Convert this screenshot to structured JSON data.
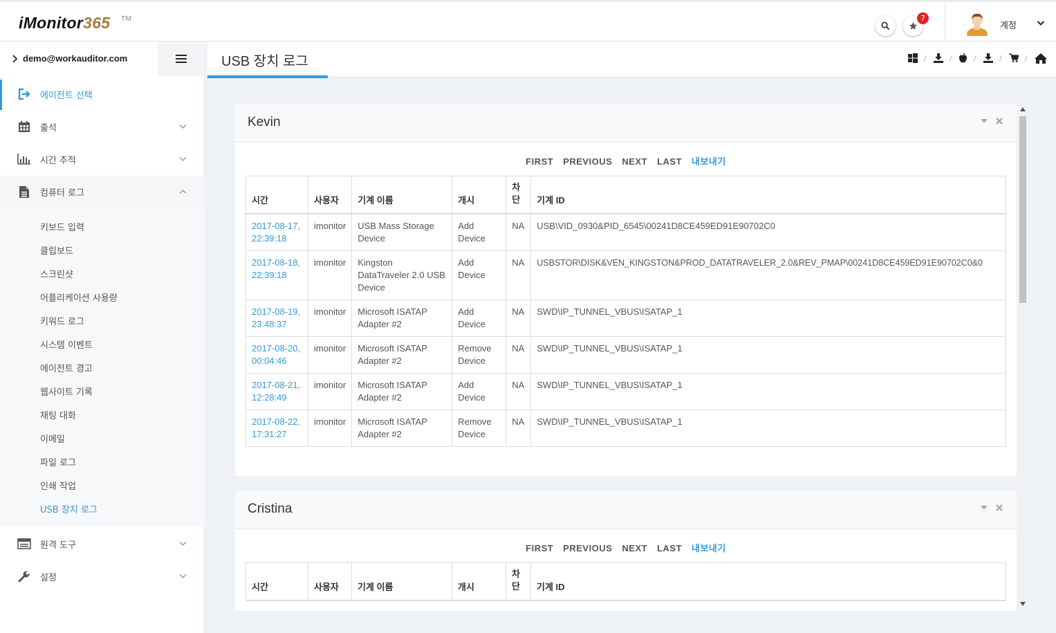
{
  "app": {
    "logo_i": "iMonitor",
    "logo_n": "365",
    "tm": "TM"
  },
  "header": {
    "badge_count": "7",
    "account_label": "계정"
  },
  "sidebar": {
    "user": "demo@workauditor.com",
    "items": [
      {
        "label": "에이전트 선택",
        "icon": "sign-in-icon",
        "active": true
      },
      {
        "label": "출석",
        "icon": "calendar-icon"
      },
      {
        "label": "시간 추적",
        "icon": "bar-chart-icon"
      },
      {
        "label": "컴퓨터 로그",
        "icon": "file-icon",
        "expanded": true
      },
      {
        "label": "원격 도구",
        "icon": "list-icon"
      },
      {
        "label": "설정",
        "icon": "wrench-icon"
      }
    ],
    "subitems": [
      "키보드 입력",
      "클립보드",
      "스크린샷",
      "어플리케이션 사용량",
      "키워드 로그",
      "시스템 이벤트",
      "에이전트 경고",
      "웹사이트 기록",
      "채팅 대화",
      "이메일",
      "파일 로그",
      "인쇄 작업",
      "USB 장치 로그"
    ]
  },
  "main": {
    "title": "USB 장치 로그",
    "breadcrumb_icons": [
      "windows-icon",
      "download-icon",
      "apple-icon",
      "download-icon",
      "cart-icon",
      "home-icon"
    ],
    "breadcrumb_sep": "/"
  },
  "pager": {
    "first": "FIRST",
    "previous": "PREVIOUS",
    "next": "NEXT",
    "last": "LAST",
    "export": "내보내기"
  },
  "columns": {
    "time": "시간",
    "user": "사용자",
    "device": "기계 이름",
    "start": "개시",
    "block1": "차",
    "block2": "단",
    "device_id": "기계 ID"
  },
  "portlets": [
    {
      "name": "Kevin",
      "rows": [
        {
          "d": "2017-08-17,",
          "t": "22:39:18",
          "user": "imonitor",
          "device": [
            "USB Mass Storage",
            "Device"
          ],
          "action": [
            "Add",
            "Device"
          ],
          "block": "NA",
          "id": "USB\\VID_0930&PID_6545\\00241D8CE459ED91E90702C0"
        },
        {
          "d": "2017-08-18,",
          "t": "22:39:18",
          "user": "imonitor",
          "device": [
            "Kingston",
            "DataTraveler 2.0 USB",
            "Device"
          ],
          "action": [
            "Add",
            "Device"
          ],
          "block": "NA",
          "id": "USBSTOR\\DISK&VEN_KINGSTON&PROD_DATATRAVELER_2.0&REV_PMAP\\00241D8CE459ED91E90702C0&0"
        },
        {
          "d": "2017-08-19,",
          "t": "23:48:37",
          "user": "imonitor",
          "device": [
            "Microsoft ISATAP",
            "Adapter #2"
          ],
          "action": [
            "Add",
            "Device"
          ],
          "block": "NA",
          "id": "SWD\\IP_TUNNEL_VBUS\\ISATAP_1"
        },
        {
          "d": "2017-08-20,",
          "t": "00:04:46",
          "user": "imonitor",
          "device": [
            "Microsoft ISATAP",
            "Adapter #2"
          ],
          "action": [
            "Remove",
            "Device"
          ],
          "block": "NA",
          "id": "SWD\\IP_TUNNEL_VBUS\\ISATAP_1"
        },
        {
          "d": "2017-08-21,",
          "t": "12:28:49",
          "user": "imonitor",
          "device": [
            "Microsoft ISATAP",
            "Adapter #2"
          ],
          "action": [
            "Add",
            "Device"
          ],
          "block": "NA",
          "id": "SWD\\IP_TUNNEL_VBUS\\ISATAP_1"
        },
        {
          "d": "2017-08-22,",
          "t": "17:31:27",
          "user": "imonitor",
          "device": [
            "Microsoft ISATAP",
            "Adapter #2"
          ],
          "action": [
            "Remove",
            "Device"
          ],
          "block": "NA",
          "id": "SWD\\IP_TUNNEL_VBUS\\ISATAP_1"
        }
      ]
    },
    {
      "name": "Cristina",
      "rows": []
    }
  ],
  "colors": {
    "accent": "#3598dc",
    "badge": "#e02222",
    "brand_gold": "#a27d3a"
  }
}
